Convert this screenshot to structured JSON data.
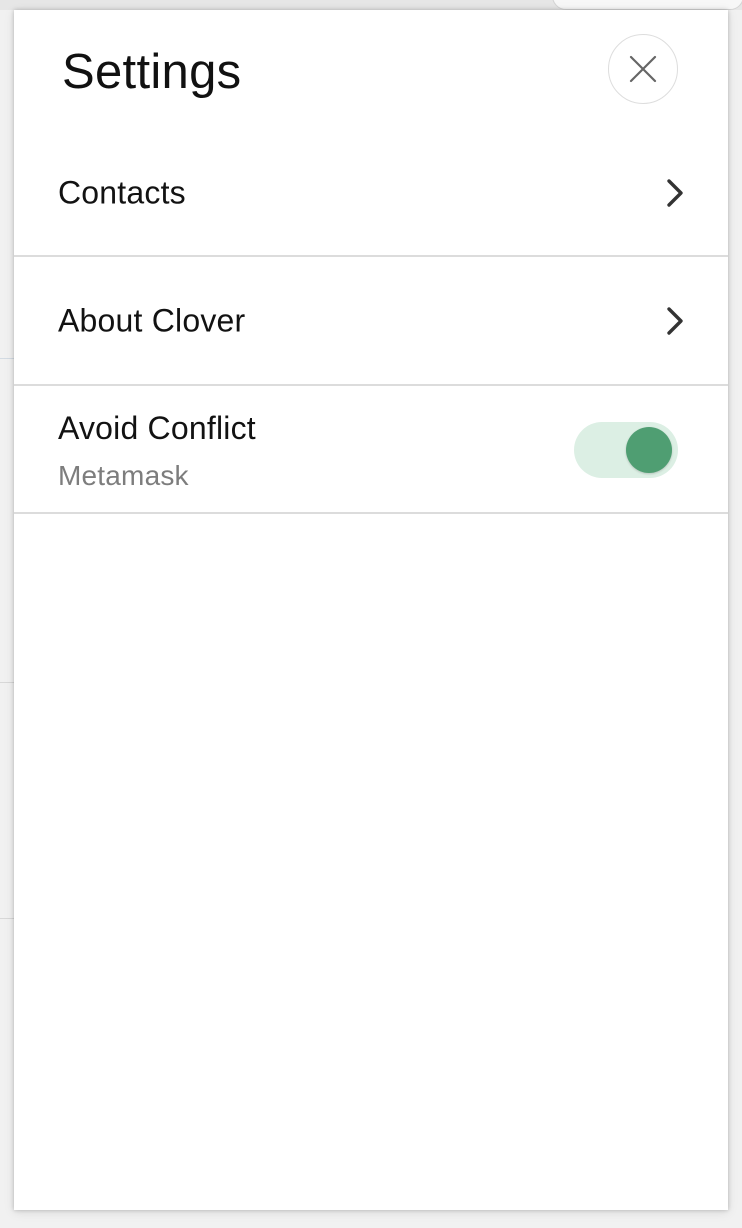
{
  "settings": {
    "title": "Settings",
    "close_icon": "close-icon",
    "items": [
      {
        "label": "Contacts",
        "icon": "chevron-right-icon"
      },
      {
        "label": "About Clover",
        "icon": "chevron-right-icon"
      }
    ],
    "toggle": {
      "label": "Avoid Conflict",
      "sublabel": "Metamask",
      "enabled": true,
      "track_color": "#dcefe4",
      "knob_color": "#4f9e72"
    }
  }
}
